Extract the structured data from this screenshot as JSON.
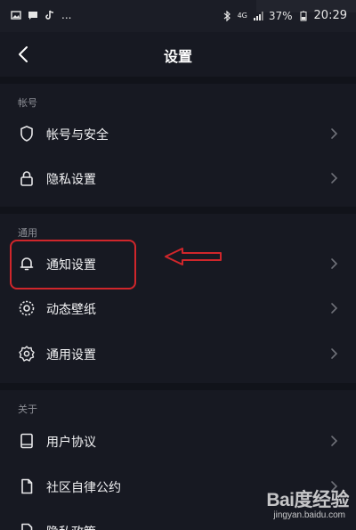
{
  "status_bar": {
    "left_icons": [
      "image-icon",
      "message-icon",
      "tiktok-icon",
      "more-icon"
    ],
    "more_text": "...",
    "network_text": "4G",
    "battery_text": "37%",
    "time": "20:29"
  },
  "header": {
    "title": "设置",
    "back_icon": "chevron-left-icon"
  },
  "sections": {
    "account": {
      "label": "帐号",
      "items": [
        {
          "label": "帐号与安全",
          "icon": "shield-icon"
        },
        {
          "label": "隐私设置",
          "icon": "lock-icon"
        }
      ]
    },
    "general": {
      "label": "通用",
      "items": [
        {
          "label": "通知设置",
          "icon": "bell-icon"
        },
        {
          "label": "动态壁纸",
          "icon": "wallpaper-icon"
        },
        {
          "label": "通用设置",
          "icon": "gear-icon"
        }
      ]
    },
    "about": {
      "label": "关于",
      "items": [
        {
          "label": "用户协议",
          "icon": "book-icon"
        },
        {
          "label": "社区自律公约",
          "icon": "document-icon"
        },
        {
          "label": "隐私政策",
          "icon": "document-icon"
        }
      ]
    }
  },
  "annotation": {
    "highlight_color": "#d0262b"
  },
  "watermark": {
    "logo": "Bai度经验",
    "url": "jingyan.baidu.com"
  },
  "colors": {
    "background": "#171922",
    "text": "#f2f2f4",
    "secondary_text": "#8d8f96",
    "divider": "#11131a"
  }
}
